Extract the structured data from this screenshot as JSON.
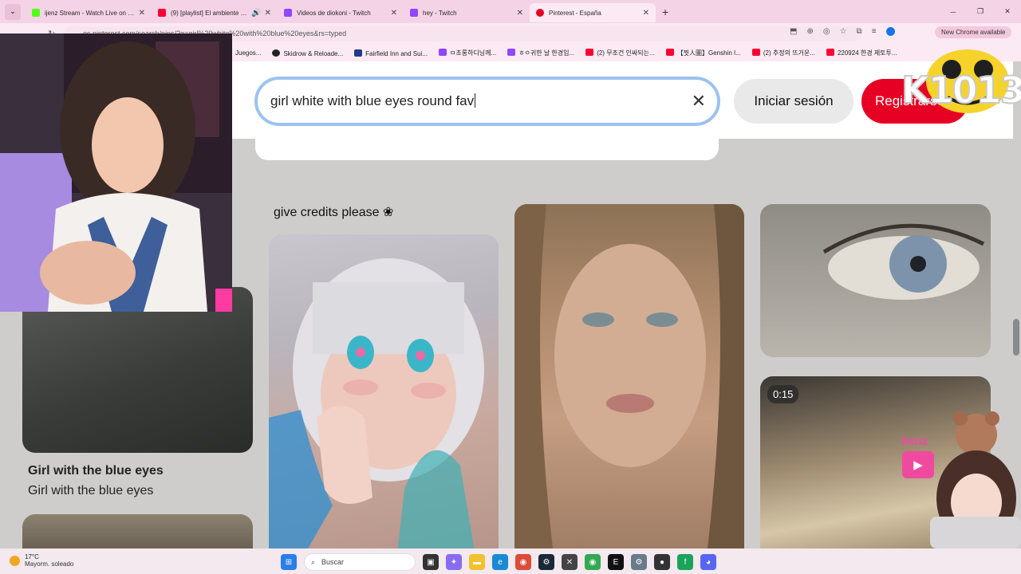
{
  "browser": {
    "tabs": [
      {
        "title": "ijenz Stream - Watch Live on K...",
        "color": "#53fc18",
        "active": false
      },
      {
        "title": "(9) [playlist] El ambiente es...",
        "color": "#ff0033",
        "active": false,
        "audio": true
      },
      {
        "title": "Videos de diokoni - Twitch",
        "color": "#9146ff",
        "active": false
      },
      {
        "title": "hey - Twitch",
        "color": "#9146ff",
        "active": false
      },
      {
        "title": "Pinterest - España",
        "color": "#e60023",
        "active": true
      }
    ],
    "url": "es.pinterest.com/search/pins/?q=girl%20white%20with%20blue%20eyes&rs=typed",
    "update_badge": "New Chrome available",
    "bookmarks": [
      {
        "label": "Juegos...",
        "color": "#888888"
      },
      {
        "label": "Skidrow & Reloade...",
        "color": "#222222"
      },
      {
        "label": "Fairfield Inn and Sui...",
        "color": "#1f3b8a"
      },
      {
        "label": "ㅁ초롱하디닝께...",
        "color": "#9146ff"
      },
      {
        "label": "ㅎㅇ귀한 날 한경입...",
        "color": "#9146ff"
      },
      {
        "label": "(2) 무조건 인싸되는...",
        "color": "#ff0033"
      },
      {
        "label": "【찟人圖】Genshin I...",
        "color": "#ff0033"
      },
      {
        "label": "(2) 추정의 뜨거운...",
        "color": "#ff0033"
      },
      {
        "label": "220924 한경 제토투...",
        "color": "#ff0033"
      }
    ]
  },
  "pinterest": {
    "search_query": "girl white with blue eyes round fav",
    "login_label": "Iniciar sesión",
    "register_label": "Registrarse",
    "pin_titles": {
      "anime_caption": "give credits please ❀",
      "blue_eyes_title": "Girl with the blue eyes",
      "blue_eyes_subtitle": "Girl with the blue eyes"
    },
    "video_duration": "0:15"
  },
  "overlay": {
    "logo_text": "K1013",
    "channel_name": "Ilenz"
  },
  "taskbar": {
    "temp": "17°C",
    "weather": "Mayorm. soleado",
    "search_placeholder": "Buscar",
    "apps": [
      "task-view",
      "copilot",
      "file-explorer",
      "edge",
      "chrome",
      "steam",
      "xbox",
      "chrome-2",
      "epic",
      "settings",
      "discord-2",
      "app-green",
      "discord"
    ]
  }
}
